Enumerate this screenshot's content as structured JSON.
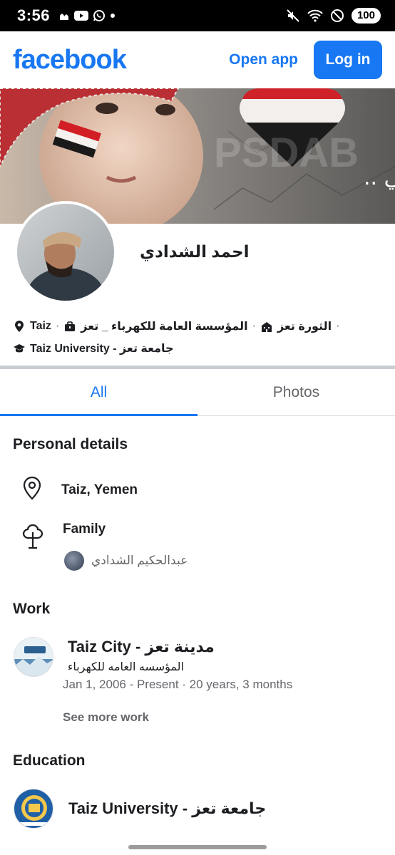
{
  "status_bar": {
    "time": "3:56",
    "battery": "100",
    "icons_left": [
      "mosque-icon",
      "youtube-icon",
      "whatsapp-icon",
      "dot-icon"
    ],
    "icons_right": [
      "mute-icon",
      "wifi-icon",
      "do-not-disturb-icon"
    ]
  },
  "header": {
    "logo": "facebook",
    "open_app": "Open app",
    "login": "Log in"
  },
  "cover": {
    "overlay_text": "شامخ كياني .."
  },
  "profile": {
    "name": "احمد الشدادي",
    "meta_line1": {
      "city": "Taiz",
      "employer": "المؤسسة العامة للكهرباء _ تعز",
      "org": "الثورة تعز"
    },
    "meta_line2": {
      "school": "جامعة تعز - Taiz University"
    }
  },
  "tabs": [
    {
      "label": "All",
      "active": true
    },
    {
      "label": "Photos",
      "active": false
    }
  ],
  "personal_details": {
    "title": "Personal details",
    "location": "Taiz, Yemen",
    "family_label": "Family",
    "family_member": "عبدالحكيم الشدادي"
  },
  "work": {
    "title": "Work",
    "company": "Taiz City - مدينة تعز",
    "position": "المؤسسه العامه للكهرباء",
    "dates": "Jan 1, 2006 - Present · 20 years, 3 months",
    "see_more": "See more work"
  },
  "education": {
    "title": "Education",
    "school": "Taiz University - جامعة تعز"
  },
  "colors": {
    "brand": "#1877f2",
    "text": "#1c1e21",
    "secondary": "#65676b"
  }
}
